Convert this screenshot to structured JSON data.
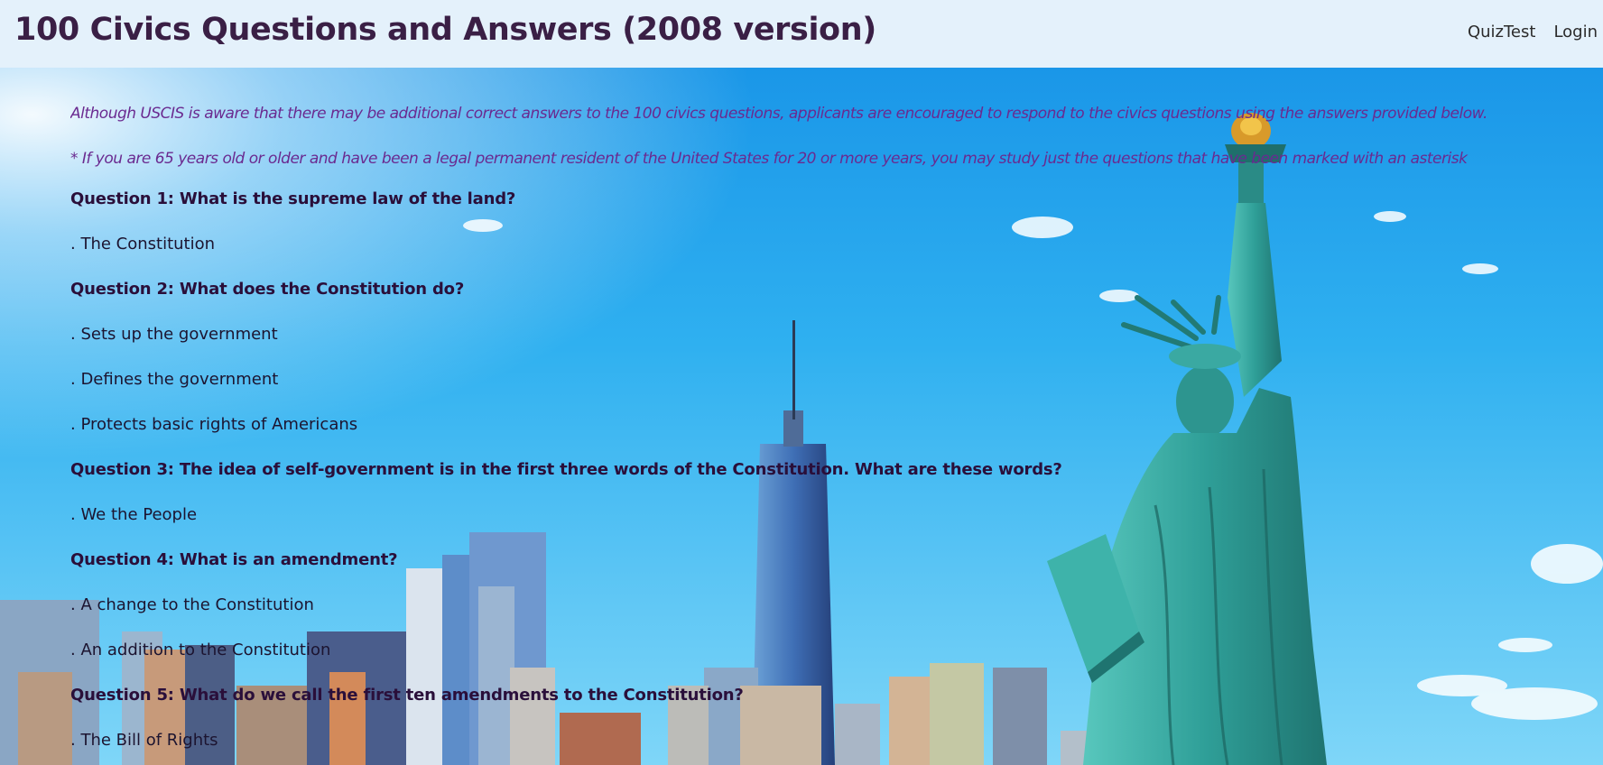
{
  "header": {
    "title": "100 Civics Questions and Answers (2008 version)",
    "nav": [
      {
        "label": "QuizTest"
      },
      {
        "label": "Login"
      }
    ]
  },
  "intro": "Although USCIS is aware that there may be additional correct answers to the 100 civics questions, applicants are encouraged to respond to the civics questions using the answers provided below.",
  "note": "* If you are 65 years old or older and have been a legal permanent resident of the United States for 20 or more years, you may study just the questions that have been marked with an asterisk",
  "lines": [
    {
      "type": "question",
      "text": "Question 1: What is the supreme law of the land?"
    },
    {
      "type": "answer",
      "text": ". The Constitution"
    },
    {
      "type": "question",
      "text": "Question 2: What does the Constitution do?"
    },
    {
      "type": "answer",
      "text": ". Sets up the government"
    },
    {
      "type": "answer",
      "text": ". Defines the government"
    },
    {
      "type": "answer",
      "text": ". Protects basic rights of Americans"
    },
    {
      "type": "question",
      "text": "Question 3: The idea of self-government is in the first three words of the Constitution. What are these words?"
    },
    {
      "type": "answer",
      "text": ". We the People"
    },
    {
      "type": "question",
      "text": "Question 4: What is an amendment?"
    },
    {
      "type": "answer",
      "text": ". A change to the Constitution"
    },
    {
      "type": "answer",
      "text": ". An addition to the Constitution"
    },
    {
      "type": "question",
      "text": "Question 5: What do we call the first ten amendments to the Constitution?"
    },
    {
      "type": "answer",
      "text": ". The Bill of Rights"
    }
  ],
  "colors": {
    "navbar_bg": "#e4f1fb",
    "title": "#3a1f45",
    "intro_text": "#6a2a90",
    "question_text": "#2a0f3a",
    "answer_text": "#1c1430",
    "sky_top": "#1b97e8",
    "sky_bottom": "#6cd0f8",
    "statue": "#2fa39c"
  }
}
